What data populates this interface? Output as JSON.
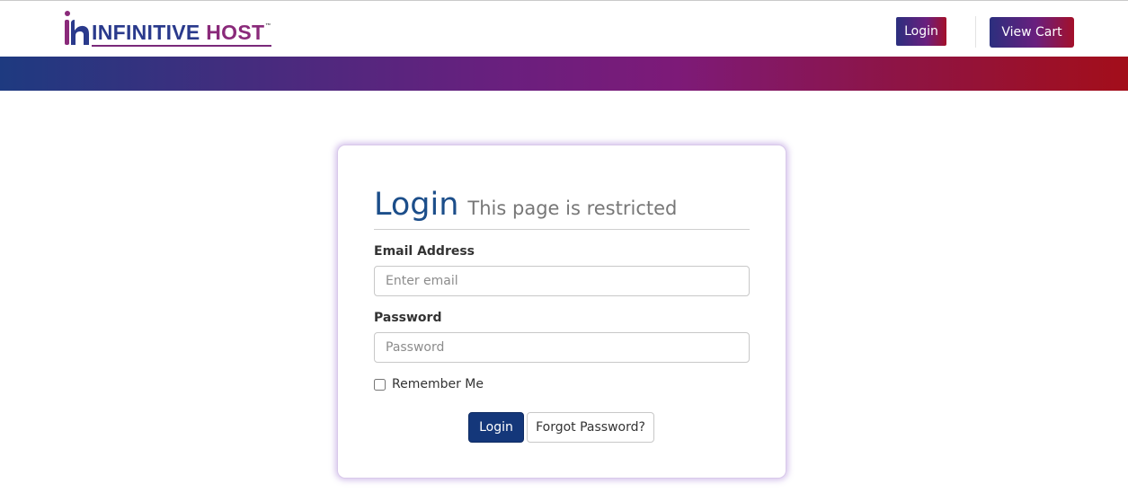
{
  "brand": {
    "name_part1": "INFINITIVE ",
    "name_part2": "HOST",
    "trademark": "™",
    "colors": {
      "blue": "#2a3a8c",
      "purple": "#8a2a7a",
      "red": "#a3102a"
    }
  },
  "header": {
    "login_label": "Login",
    "cart_label": "View Cart"
  },
  "login_card": {
    "title": "Login",
    "subtitle": "This page is restricted",
    "email_label": "Email Address",
    "email_placeholder": "Enter email",
    "email_value": "",
    "password_label": "Password",
    "password_placeholder": "Password",
    "password_value": "",
    "remember_label": "Remember Me",
    "remember_checked": false,
    "submit_label": "Login",
    "forgot_label": "Forgot Password?"
  }
}
